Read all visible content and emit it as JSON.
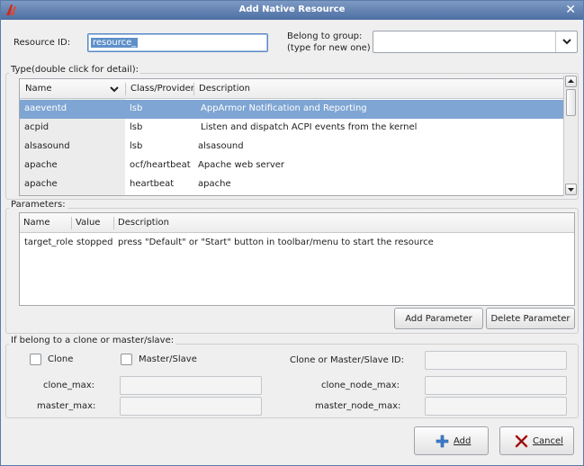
{
  "window": {
    "title": "Add Native Resource"
  },
  "resource_id": {
    "label": "Resource ID:",
    "value": "resource_"
  },
  "group": {
    "label_line1": "Belong to group:",
    "label_line2": "(type for new one)",
    "value": ""
  },
  "type_section": {
    "label": "Type(double click for detail):",
    "columns": [
      "Name",
      "Class/Provider",
      "Description"
    ],
    "rows": [
      {
        "name": "aaeventd",
        "provider": "lsb",
        "description": "AppArmor Notification and Reporting"
      },
      {
        "name": "acpid",
        "provider": "lsb",
        "description": "Listen and dispatch ACPI events from the kernel"
      },
      {
        "name": "alsasound",
        "provider": "lsb",
        "description": "alsasound"
      },
      {
        "name": "apache",
        "provider": "ocf/heartbeat",
        "description": "Apache web server"
      },
      {
        "name": "apache",
        "provider": "heartbeat",
        "description": "apache"
      }
    ]
  },
  "parameters": {
    "label": "Parameters:",
    "columns": [
      "Name",
      "Value",
      "Description"
    ],
    "rows": [
      {
        "name": "target_role",
        "value": "stopped",
        "description": "press \"Default\" or \"Start\" button in toolbar/menu to start the resource"
      }
    ],
    "add_button": "Add Parameter",
    "delete_button": "Delete Parameter"
  },
  "clone_section": {
    "label": "If belong to a clone or master/slave:",
    "clone_label": "Clone",
    "master_slave_label": "Master/Slave",
    "clone_id_label": "Clone or Master/Slave ID:",
    "clone_max_label": "clone_max:",
    "clone_node_max_label": "clone_node_max:",
    "master_max_label": "master_max:",
    "master_node_max_label": "master_node_max:"
  },
  "buttons": {
    "add": "Add",
    "cancel": "Cancel"
  },
  "colors": {
    "selection": "#7ea5d3",
    "titlebar": "#4d6fa3",
    "add_icon": "#3f7fd0",
    "cancel_icon": "#cc1a1a"
  }
}
